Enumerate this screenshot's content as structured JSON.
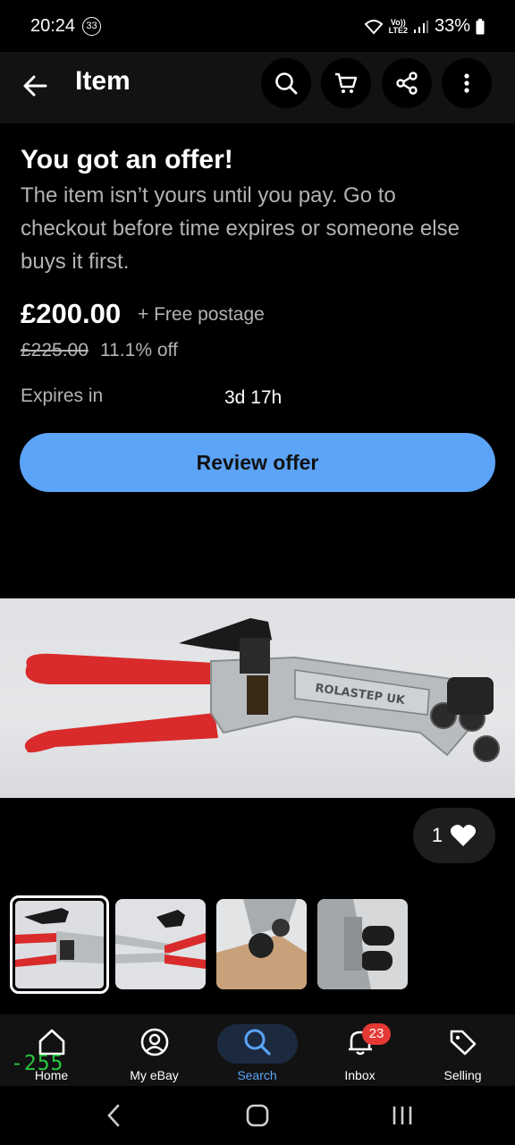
{
  "status_bar": {
    "time": "20:24",
    "notification_count": "33",
    "network": "LTE2",
    "network_vol": "Vo))",
    "battery": "33%"
  },
  "app_bar": {
    "title": "Item",
    "icons": [
      "back-arrow-icon",
      "search-icon",
      "cart-icon",
      "share-icon",
      "more-vertical-icon"
    ]
  },
  "offer": {
    "heading": "You got an offer!",
    "description": "The item isn’t yours until you pay. Go to checkout before time expires or someone else buys it first.",
    "price": "£200.00",
    "postage": "+ Free postage",
    "original_price": "£225.00",
    "discount": "11.1% off",
    "expires_label": "Expires in",
    "expires_value": "3d 17h",
    "button_label": "Review offer",
    "button_color": "#5ba4f8"
  },
  "product": {
    "image_text": "ROLASTEP UK",
    "watchers": "1"
  },
  "thumbnails": {
    "count": 4,
    "selected_index": 0
  },
  "bottom_nav": {
    "items": [
      {
        "label": "Home",
        "icon": "home-icon"
      },
      {
        "label": "My eBay",
        "icon": "profile-icon"
      },
      {
        "label": "Search",
        "icon": "search-icon"
      },
      {
        "label": "Inbox",
        "icon": "bell-icon",
        "badge": "23"
      },
      {
        "label": "Selling",
        "icon": "tag-icon"
      }
    ],
    "active_index": 2,
    "active_color": "#5ba4f8"
  },
  "debug_overlay": "-255"
}
